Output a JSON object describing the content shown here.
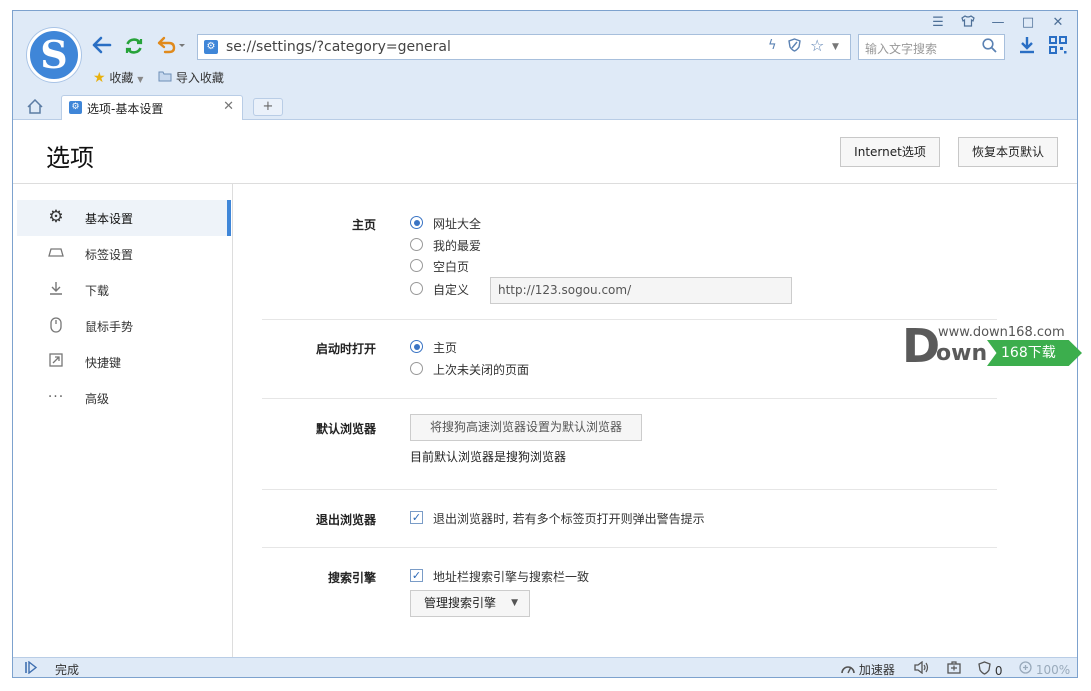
{
  "window_controls": [
    "☰",
    "👕",
    "—",
    "□",
    "✕"
  ],
  "logo_letter": "S",
  "address": {
    "url": "se://settings/?category=general"
  },
  "search": {
    "placeholder": "输入文字搜索"
  },
  "favbar": {
    "favorites": "收藏",
    "import": "导入收藏"
  },
  "tab": {
    "label": "选项-基本设置",
    "new_tab": "+"
  },
  "page": {
    "title": "选项",
    "internet_options": "Internet选项",
    "restore_defaults": "恢复本页默认"
  },
  "sidebar": {
    "items": [
      {
        "label": "基本设置",
        "active": true
      },
      {
        "label": "标签设置"
      },
      {
        "label": "下载"
      },
      {
        "label": "鼠标手势"
      },
      {
        "label": "快捷键"
      },
      {
        "label": "高级"
      }
    ]
  },
  "sections": {
    "homepage": {
      "label": "主页",
      "options": [
        "网址大全",
        "我的最爱",
        "空白页",
        "自定义"
      ],
      "selected": "网址大全",
      "custom_url": "http://123.sogou.com/"
    },
    "startup": {
      "label": "启动时打开",
      "options": [
        "主页",
        "上次未关闭的页面"
      ],
      "selected": "主页"
    },
    "default_browser": {
      "label": "默认浏览器",
      "button": "将搜狗高速浏览器设置为默认浏览器",
      "status": "目前默认浏览器是搜狗浏览器"
    },
    "exit": {
      "label": "退出浏览器",
      "checkbox": "退出浏览器时, 若有多个标签页打开则弹出警告提示",
      "checked": true
    },
    "search_engine": {
      "label": "搜索引擎",
      "checkbox": "地址栏搜索引擎与搜索栏一致",
      "checked": true,
      "manage": "管理搜索引擎"
    }
  },
  "statusbar": {
    "text": "完成",
    "accelerator": "加速器",
    "shield_count": "0",
    "zoom": "100%"
  },
  "watermark": {
    "site": "www.down168.com",
    "brand": "own",
    "tag": "168下载",
    "big_letter": "D"
  },
  "colors": {
    "accent": "#3f86d8",
    "chrome": "#dfeaf7",
    "watermark_green": "#3cae4d"
  }
}
